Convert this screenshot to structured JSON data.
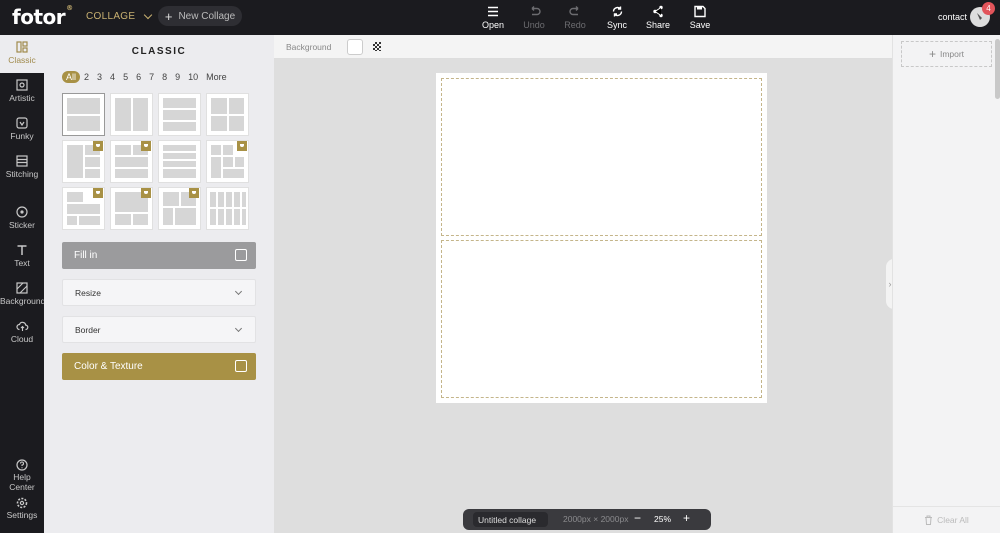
{
  "brand": {
    "name": "fotor",
    "mark": "®"
  },
  "header": {
    "mode": "COLLAGE",
    "new_collage": "New Collage",
    "tools": [
      {
        "label": "Open",
        "icon": "menu-icon",
        "enabled": true
      },
      {
        "label": "Undo",
        "icon": "undo-icon",
        "enabled": false
      },
      {
        "label": "Redo",
        "icon": "redo-icon",
        "enabled": false
      },
      {
        "label": "Sync",
        "icon": "sync-icon",
        "enabled": true
      },
      {
        "label": "Share",
        "icon": "share-icon",
        "enabled": true
      },
      {
        "label": "Save",
        "icon": "save-icon",
        "enabled": true
      }
    ],
    "user": "contact",
    "notifications": "4"
  },
  "sidebar": {
    "items": [
      {
        "label": "Classic",
        "icon": "grid-icon",
        "active": true
      },
      {
        "label": "Artistic",
        "icon": "artistic-icon",
        "active": false
      },
      {
        "label": "Funky",
        "icon": "funky-icon",
        "active": false
      },
      {
        "label": "Stitching",
        "icon": "stitching-icon",
        "active": false
      },
      {
        "label": "Sticker",
        "icon": "sticker-icon",
        "active": false
      },
      {
        "label": "Text",
        "icon": "text-icon",
        "active": false
      },
      {
        "label": "Background",
        "icon": "background-icon",
        "active": false
      },
      {
        "label": "Cloud",
        "icon": "cloud-icon",
        "active": false
      }
    ],
    "bottom": [
      {
        "label": "Help Center",
        "icon": "help-icon"
      },
      {
        "label": "Settings",
        "icon": "settings-icon"
      }
    ]
  },
  "panel": {
    "title": "CLASSIC",
    "filters": [
      "All",
      "2",
      "3",
      "4",
      "5",
      "6",
      "7",
      "8",
      "9",
      "10",
      "More"
    ],
    "active_filter": "All",
    "fill_in": "Fill in",
    "resize": "Resize",
    "border": "Border",
    "color_texture": "Color & Texture",
    "accent": "#a89145"
  },
  "canvas": {
    "background_label": "Background",
    "title": "Untitled collage",
    "dimensions": "2000px × 2000px",
    "zoom": "25%",
    "minus": "−",
    "plus": "+"
  },
  "right_panel": {
    "import": "Import",
    "clear_all": "Clear All"
  }
}
